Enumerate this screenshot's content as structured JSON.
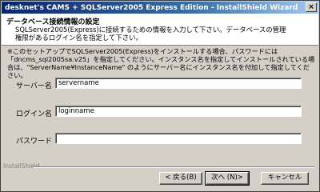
{
  "window": {
    "title": "desknet's CAMS + SQLServer2005 Express Edition - InstallShield Wizard",
    "close_glyph": "×"
  },
  "header": {
    "title": "データベース接続情報の設定",
    "description": "SQLServer2005(Express)に接続するための情報を入力して下さい。データベースの管理権限があるログイン名を指定して下さい。"
  },
  "note": "※このセットアップでSQLServer2005(Express)をインストールする場合、パスワードには「dncms_sql2005sa.v25」を指定してください。インスタンス名を指定してインストールされている場合は、\"ServerName¥InstanceName\" のようにサーバー名にインスタンス名を付加して指定してください。",
  "fields": {
    "server": {
      "label": "サーバー名",
      "value": "servername"
    },
    "login": {
      "label": "ログイン名",
      "value": "loginname"
    },
    "password": {
      "label": "パスワード",
      "value": ""
    }
  },
  "footer": {
    "brand": "InstallShield",
    "back_label": "< 戻る(B)",
    "next_label": "次へ (N)>",
    "cancel_label": "キャンセル"
  },
  "colors": {
    "titlebar_start": "#0a246a",
    "titlebar_end": "#a6caf0",
    "dialog_bg": "#d4d0c8"
  }
}
